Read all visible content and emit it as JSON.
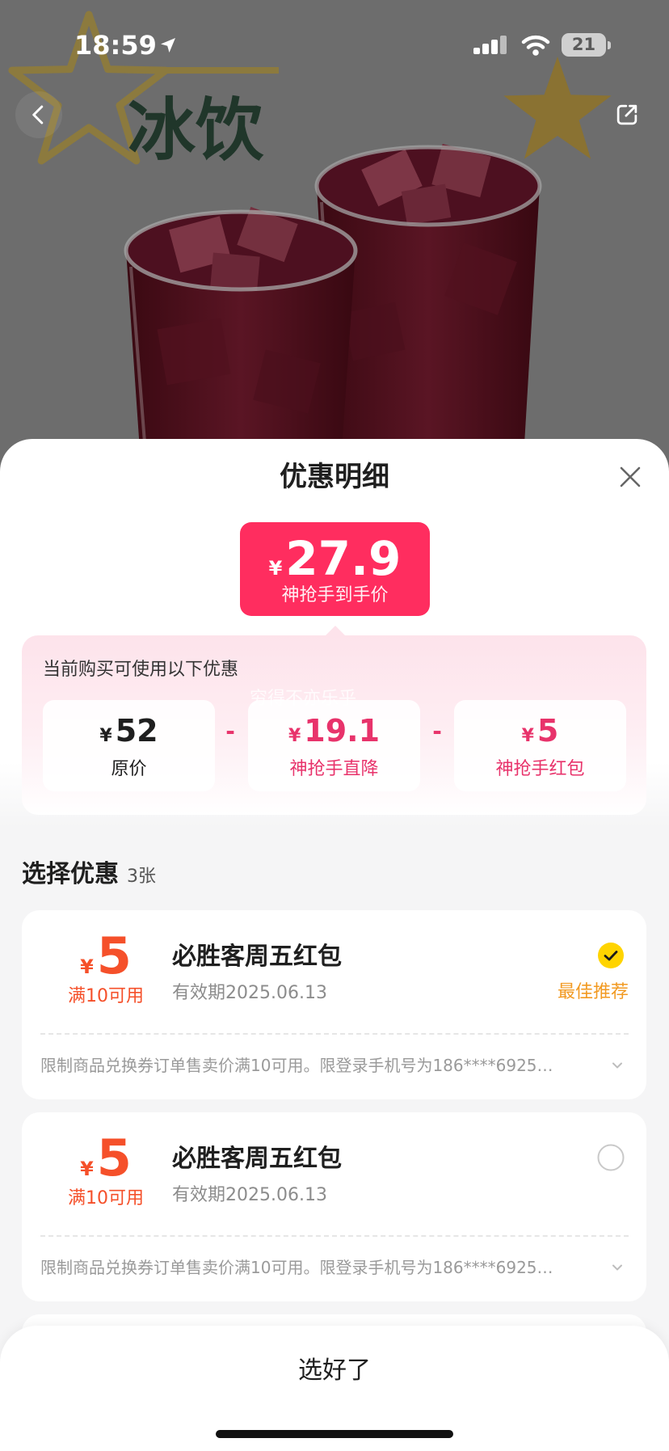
{
  "status_bar": {
    "time": "18:59",
    "battery": "21",
    "icons": [
      "location-arrow-icon",
      "cellular-signal-icon",
      "wifi-icon",
      "battery-icon"
    ]
  },
  "hero": {
    "headline": "冰饮",
    "back_icon": "chevron-left-icon",
    "share_icon": "share-icon"
  },
  "sheet": {
    "title": "优惠明细",
    "close_icon": "close-icon",
    "final_price": {
      "currency": "¥",
      "amount": "27.9",
      "label": "神抢手到手价"
    },
    "breakdown": {
      "caption": "当前购买可使用以下优惠",
      "watermark": "穷得不亦乐乎",
      "items": [
        {
          "currency": "¥",
          "amount": "52",
          "label": "原价"
        },
        {
          "currency": "¥",
          "amount": "19.1",
          "label": "神抢手直降"
        },
        {
          "currency": "¥",
          "amount": "5",
          "label": "神抢手红包"
        }
      ],
      "operators": [
        "-",
        "-"
      ]
    },
    "coupon_section": {
      "title": "选择优惠",
      "count": "3张"
    },
    "coupons": [
      {
        "currency": "¥",
        "amount": "5",
        "condition": "满10可用",
        "name": "必胜客周五红包",
        "validity": "有效期2025.06.13",
        "selected": true,
        "tag": "最佳推荐",
        "terms": "限制商品兑换券订单售卖价满10可用。限登录手机号为186****6925…",
        "expand_icon": "chevron-down-icon"
      },
      {
        "currency": "¥",
        "amount": "5",
        "condition": "满10可用",
        "name": "必胜客周五红包",
        "validity": "有效期2025.06.13",
        "selected": false,
        "terms": "限制商品兑换券订单售卖价满10可用。限登录手机号为186****6925…",
        "expand_icon": "chevron-down-icon"
      }
    ]
  },
  "footer": {
    "confirm_label": "选好了"
  },
  "colors": {
    "price_badge": "#FF2D5F",
    "discount_pink": "#E8336B",
    "coupon_amount": "#F5502A",
    "best_tag": "#F29A22",
    "selected_check": "#FFD400"
  }
}
